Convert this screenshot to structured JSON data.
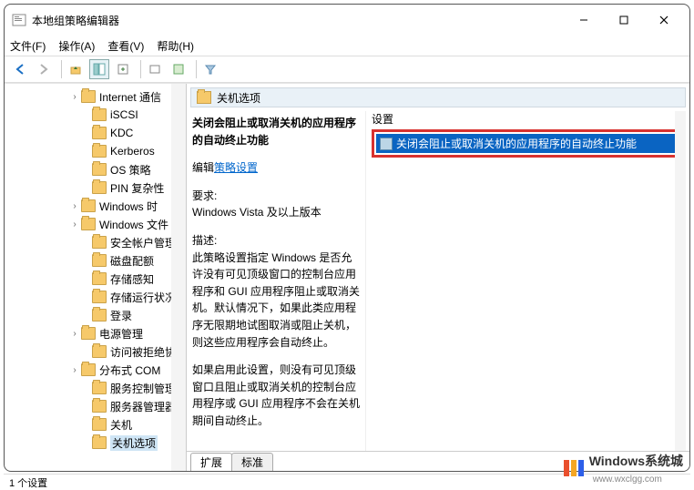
{
  "window": {
    "title": "本地组策略编辑器"
  },
  "menus": {
    "file": "文件(F)",
    "action": "操作(A)",
    "view": "查看(V)",
    "help": "帮助(H)"
  },
  "tree": {
    "items": [
      {
        "label": "Internet 通信",
        "exp": "›",
        "indent": 72
      },
      {
        "label": "iSCSI",
        "exp": "",
        "indent": 84
      },
      {
        "label": "KDC",
        "exp": "",
        "indent": 84
      },
      {
        "label": "Kerberos",
        "exp": "",
        "indent": 84
      },
      {
        "label": "OS 策略",
        "exp": "",
        "indent": 84
      },
      {
        "label": "PIN 复杂性",
        "exp": "",
        "indent": 84
      },
      {
        "label": "Windows 时",
        "exp": "›",
        "indent": 72
      },
      {
        "label": "Windows 文件",
        "exp": "›",
        "indent": 72
      },
      {
        "label": "安全帐户管理",
        "exp": "",
        "indent": 84
      },
      {
        "label": "磁盘配额",
        "exp": "",
        "indent": 84
      },
      {
        "label": "存储感知",
        "exp": "",
        "indent": 84
      },
      {
        "label": "存储运行状况",
        "exp": "",
        "indent": 84
      },
      {
        "label": "登录",
        "exp": "",
        "indent": 84
      },
      {
        "label": "电源管理",
        "exp": "›",
        "indent": 72
      },
      {
        "label": "访问被拒绝协",
        "exp": "",
        "indent": 84
      },
      {
        "label": "分布式 COM",
        "exp": "›",
        "indent": 72
      },
      {
        "label": "服务控制管理",
        "exp": "",
        "indent": 84
      },
      {
        "label": "服务器管理器",
        "exp": "",
        "indent": 84
      },
      {
        "label": "关机",
        "exp": "",
        "indent": 84
      },
      {
        "label": "关机选项",
        "exp": "",
        "indent": 84,
        "selected": true
      }
    ]
  },
  "detail": {
    "header": "关机选项",
    "policy_title": "关闭会阻止或取消关机的应用程序的自动终止功能",
    "edit_label_prefix": "编辑",
    "edit_link": "策略设置",
    "req_label": "要求:",
    "req_value": "Windows Vista 及以上版本",
    "desc_label": "描述:",
    "desc_p1": "此策略设置指定 Windows 是否允许没有可见顶级窗口的控制台应用程序和 GUI 应用程序阻止或取消关机。默认情况下，如果此类应用程序无限期地试图取消或阻止关机，则这些应用程序会自动终止。",
    "desc_p2": "如果启用此设置，则没有可见顶级窗口且阻止或取消关机的控制台应用程序或 GUI 应用程序不会在关机期间自动终止。",
    "col_header": "设置",
    "selected_setting": "关闭会阻止或取消关机的应用程序的自动终止功能"
  },
  "tabs": {
    "ext": "扩展",
    "std": "标准"
  },
  "status": "1 个设置",
  "watermark": {
    "brand": "Windows系统城",
    "url": "www.wxclgg.com"
  }
}
